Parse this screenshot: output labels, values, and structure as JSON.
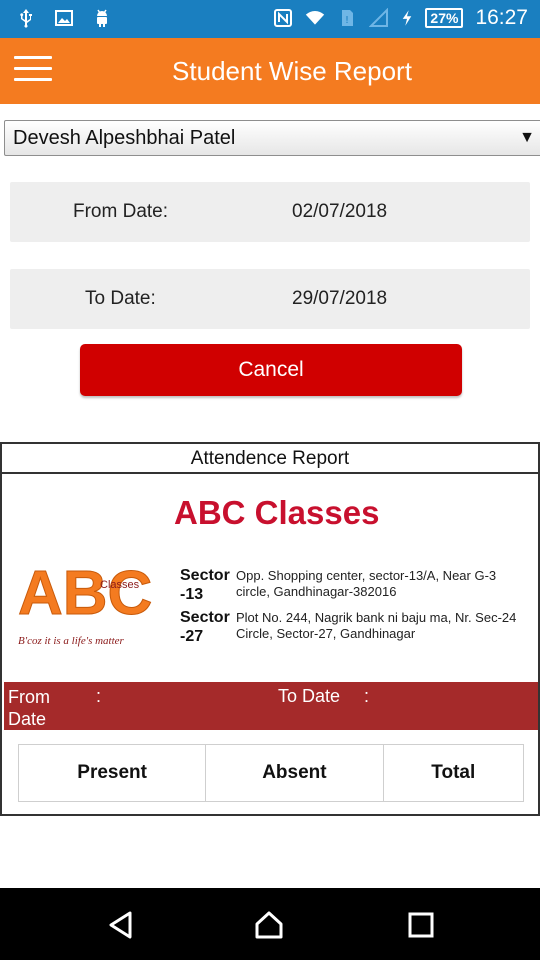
{
  "status_bar": {
    "time": "16:27",
    "battery": "27%",
    "icons": [
      "usb-icon",
      "image-icon",
      "android-icon",
      "nfc-icon",
      "wifi-icon",
      "sim-icon",
      "signal-icon",
      "charging-icon"
    ]
  },
  "app_bar": {
    "title": "Student Wise Report",
    "menu_icon": "hamburger-icon",
    "color": "#f47b20"
  },
  "form": {
    "student": "Devesh Alpeshbhai Patel",
    "from_label": "From Date:",
    "from_value": "02/07/2018",
    "to_label": "To Date:",
    "to_value": "29/07/2018",
    "cancel_label": "Cancel"
  },
  "report": {
    "header": "Attendence Report",
    "org_name": "ABC Classes",
    "logo_text": "ABC",
    "logo_sub": "Classes",
    "logo_tagline": "B'coz it is a life's matter",
    "addresses": [
      {
        "tag": "Sector -13",
        "text": "Opp. Shopping center, sector-13/A, Near G-3 circle, Gandhinagar-382016"
      },
      {
        "tag": "Sector -27",
        "text": "Plot No. 244, Nagrik bank ni baju ma, Nr. Sec-24 Circle, Sector-27, Gandhinagar"
      }
    ],
    "from_date_label": "From Date",
    "to_date_label": "To Date",
    "colon": ":",
    "columns": [
      "Present",
      "Absent",
      "Total"
    ],
    "strip_color": "#a52a2a"
  }
}
